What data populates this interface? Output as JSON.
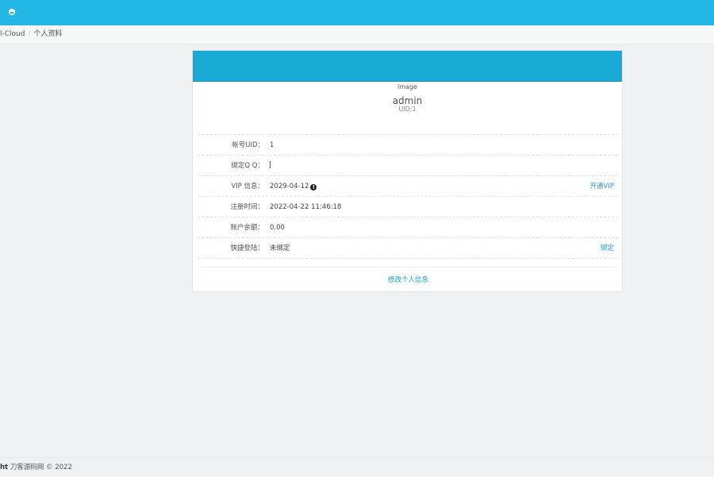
{
  "breadcrumb": {
    "items": [
      "l-Cloud",
      "个人资料"
    ],
    "separator": "/"
  },
  "profile": {
    "avatar_alt": "image",
    "username": "admin",
    "uid_line": "UID:1"
  },
  "info_rows": [
    {
      "label": "帐号UID：",
      "value": "1",
      "action": ""
    },
    {
      "label": "绑定Q Q：",
      "value": "",
      "action": ""
    },
    {
      "label": "VIP 信息：",
      "value": "2029-04-12",
      "action": "开通VIP"
    },
    {
      "label": "注册时间：",
      "value": "2022-04-22 11:46:18",
      "action": ""
    },
    {
      "label": "账户余额：",
      "value": "0.00",
      "action": ""
    },
    {
      "label": "快捷登陆：",
      "value": "未绑定",
      "action": "绑定"
    }
  ],
  "edit_link": "修改个人信息",
  "footer": {
    "bold": "ht",
    "text": " 刀客源码网 © 2022"
  },
  "colors": {
    "topbar": "#23b7e5",
    "card_header": "#19a9d5",
    "link": "#1d9bd7"
  },
  "icons": {
    "user": "user-circle-icon",
    "info": "exclamation-circle-icon"
  }
}
